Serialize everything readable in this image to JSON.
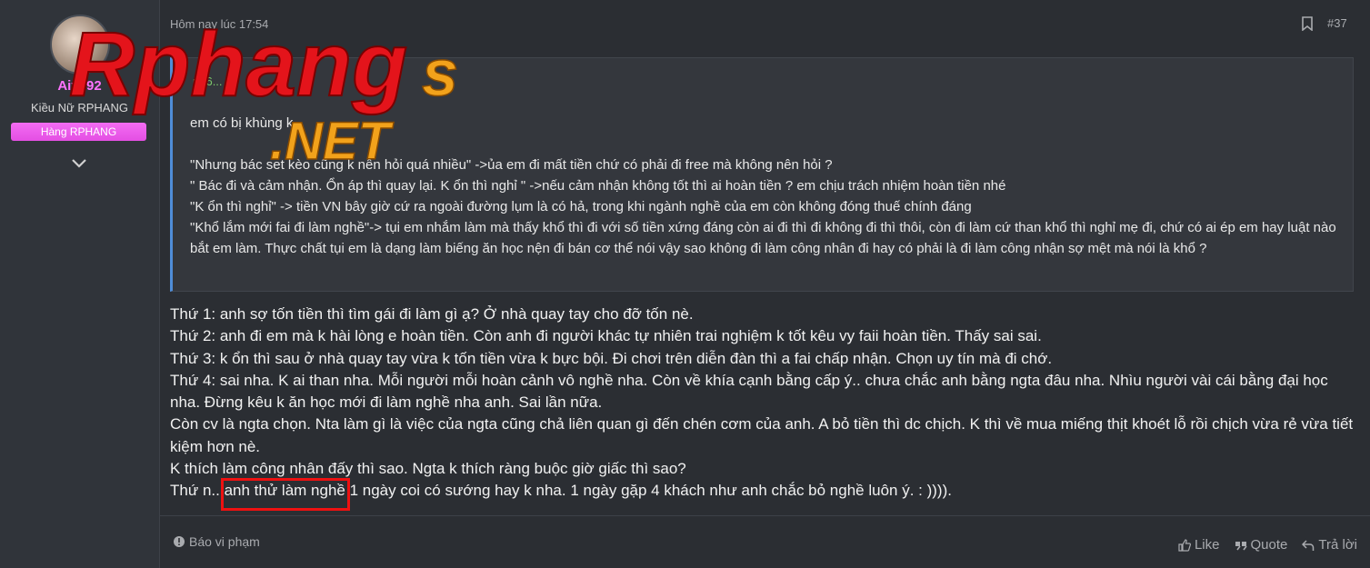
{
  "sidebar": {
    "username": "Aivy92",
    "user_title": "Kiều Nữ RPHANG",
    "rank_badge": "Hàng RPHANG"
  },
  "watermark": {
    "primary": "Rphang",
    "suffix": "s",
    "domain": ".NET",
    "colors": {
      "red": "#e4141b",
      "orange": "#f2a21b"
    }
  },
  "post": {
    "date": "Hôm nay lúc 17:54",
    "number": "#37",
    "quote": {
      "author": "ng6...",
      "lines": [
        "em có bị khùng k... ",
        "",
        "\"Nhưng bác set kèo cũng k nên hỏi quá nhiều\" ->ủa em đi mất tiền chứ có phải đi free mà không nên hỏi ?",
        "\" Bác đi và cảm nhận. Ổn áp thì quay lại. K ổn thì nghỉ \" ->nếu cảm nhận không tốt thì ai hoàn tiền ? em chịu trách nhiệm hoàn tiền nhé",
        "\"K ổn thì nghỉ\" -> tiền VN bây giờ cứ ra ngoài đường lụm là có hả, trong khi ngành nghề của em còn không đóng thuế chính đáng",
        "\"Khổ lắm mới fai đi làm nghề\"-> tụi em nhắm làm mà thấy khổ thì đi với số tiền xứng đáng còn ai đi thì đi không đi thì thôi, còn đi làm cứ than khổ thì nghỉ mẹ đi, chứ có ai ép em hay luật nào bắt em làm. Thực chất tụi em là dạng làm biếng ăn học nện đi bán cơ thể nói vậy sao không đi làm công nhân đi hay có phải là đi làm công nhận sợ mệt mà nói là khổ ?"
      ]
    },
    "body": [
      "Thứ 1: anh sợ tốn tiền thì tìm gái đi làm gì ạ? Ở nhà quay tay cho đỡ tốn nè.",
      "Thứ 2: anh đi em mà k hài lòng e hoàn tiền. Còn anh đi người khác tự nhiên trai nghiệm k tốt kêu vy faii hoàn tiền. Thấy sai sai.",
      "Thứ 3: k ổn thì sau ở nhà quay tay vừa k tốn tiền vừa k bực bội. Đi chơi trên diễn đàn thì a fai chấp nhận. Chọn uy tín mà đi chớ.",
      "Thứ 4: sai nha. K ai than nha. Mỗi người mỗi hoàn cảnh vô nghề nha. Còn về khía cạnh bằng cấp ý.. chưa chắc anh bằng ngta đâu nha. Nhìu người vài cái bằng đại học nha. Đừng kêu k ăn học mới đi làm nghề nha anh. Sai lần nữa.",
      "Còn cv là ngta chọn. Nta làm gì là việc của ngta cũng chả liên quan gì đến chén cơm của anh. A bỏ tiền thì dc chịch. K thì về mua miếng thịt khoét lỗ rồi chịch vừa rẻ vừa tiết kiệm hơn nè.",
      "K thích làm công nhân đấy thì sao. Ngta k thích ràng buộc giờ giấc thì sao?",
      "Thứ n.. anh thử làm nghề 1 ngày coi có sướng hay k nha. 1 ngày gặp 4 khách như anh chắc bỏ nghề luôn ý. : ))))."
    ],
    "report_label": "Báo vi phạm",
    "like_label": "Like",
    "quote_label": "Quote",
    "reply_label": "Trả lời"
  },
  "colors": {
    "background": "#2b2e33",
    "username": "#ff73ff",
    "rank_badge": "#e44fe3",
    "quote_bar": "#4f8dd8",
    "highlight": "#ee1111"
  }
}
